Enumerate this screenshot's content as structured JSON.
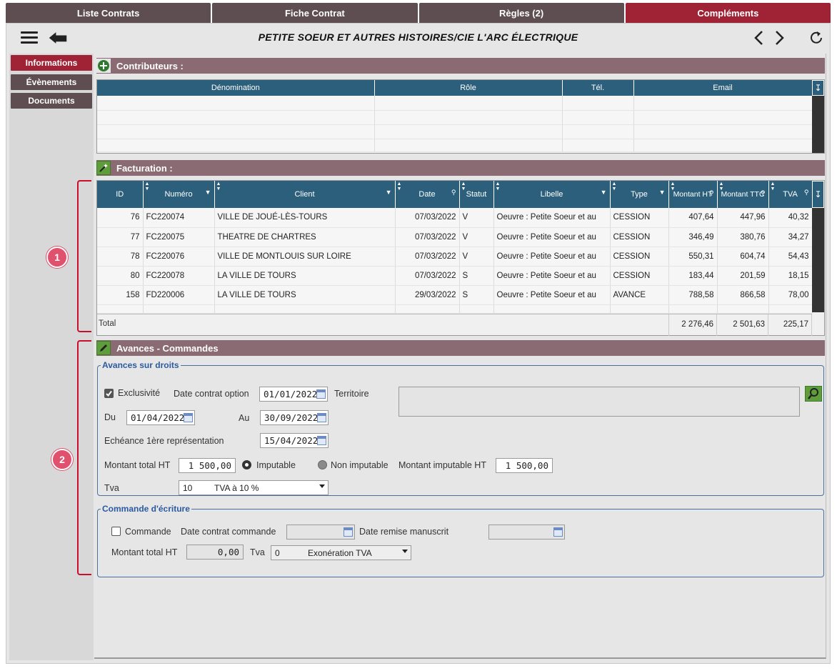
{
  "tabs": [
    "Liste Contrats",
    "Fiche Contrat",
    "Règles (2)",
    "Compléments"
  ],
  "header": {
    "title": "PETITE SOEUR ET AUTRES HISTOIRES/CIE L'ARC ÉLECTRIQUE"
  },
  "sidenav": [
    "Informations",
    "Évènements",
    "Documents"
  ],
  "contributeurs": {
    "title": "Contributeurs :",
    "columns": [
      "Dénomination",
      "Rôle",
      "Tél.",
      "Email"
    ]
  },
  "facturation": {
    "title": "Facturation :",
    "columns": [
      "ID",
      "Numéro",
      "Client",
      "Date",
      "Statut",
      "Libelle",
      "Type",
      "Montant HT",
      "Montant TTC",
      "TVA"
    ],
    "rows": [
      [
        "76",
        "FC220074",
        "VILLE DE JOUÉ-LÈS-TOURS",
        "07/03/2022",
        "V",
        "Oeuvre : Petite Soeur et au",
        "CESSION",
        "407,64",
        "447,96",
        "40,32"
      ],
      [
        "77",
        "FC220075",
        "THEATRE DE CHARTRES",
        "07/03/2022",
        "V",
        "Oeuvre : Petite Soeur et au",
        "CESSION",
        "346,49",
        "380,76",
        "34,27"
      ],
      [
        "78",
        "FC220076",
        "VILLE DE MONTLOUIS SUR LOIRE",
        "07/03/2022",
        "V",
        "Oeuvre : Petite Soeur et au",
        "CESSION",
        "550,31",
        "604,74",
        "54,43"
      ],
      [
        "80",
        "FC220078",
        "LA VILLE DE TOURS",
        "07/03/2022",
        "S",
        "Oeuvre : Petite Soeur et au",
        "CESSION",
        "183,44",
        "201,59",
        "18,15"
      ],
      [
        "158",
        "FD220006",
        "LA VILLE DE TOURS",
        "29/03/2022",
        "S",
        "Oeuvre : Petite Soeur et au",
        "AVANCE",
        "788,58",
        "866,58",
        "78,00"
      ]
    ],
    "total_label": "Total",
    "total_ht": "2 276,46",
    "total_ttc": "2 501,63",
    "total_tva": "225,17"
  },
  "avances": {
    "title": "Avances - Commandes",
    "fieldset_title": "Avances sur droits",
    "exclusivite_label": "Exclusivité",
    "exclusivite_checked": true,
    "date_contrat_option_label": "Date contrat option",
    "date_contrat_option": "01/01/2022",
    "territoire_label": "Territoire",
    "du_label": "Du",
    "du": "01/04/2022",
    "au_label": "Au",
    "au": "30/09/2022",
    "echeance_label": "Echéance 1ère représentation",
    "echeance": "15/04/2022",
    "montant_total_label": "Montant total HT",
    "montant_total": "1 500,00",
    "imputable_label": "Imputable",
    "non_imputable_label": "Non imputable",
    "montant_imputable_label": "Montant imputable HT",
    "montant_imputable": "1 500,00",
    "tva_label": "Tva",
    "tva_code": "10",
    "tva_text": "TVA à 10 %"
  },
  "commande": {
    "fieldset_title": "Commande d'écriture",
    "commande_label": "Commande",
    "date_contrat_commande_label": "Date contrat commande",
    "date_remise_label": "Date remise manuscrit",
    "montant_total_label": "Montant total HT",
    "montant_total": "0,00",
    "tva_label": "Tva",
    "tva_code": "0",
    "tva_text": "Exonération TVA"
  },
  "annotations": [
    "1",
    "2"
  ],
  "colors": {
    "accent": "#a02335",
    "tab": "#5e4e52",
    "section": "#8a6b74",
    "table_header": "#2c5f7c",
    "badge": "#e0516d"
  }
}
